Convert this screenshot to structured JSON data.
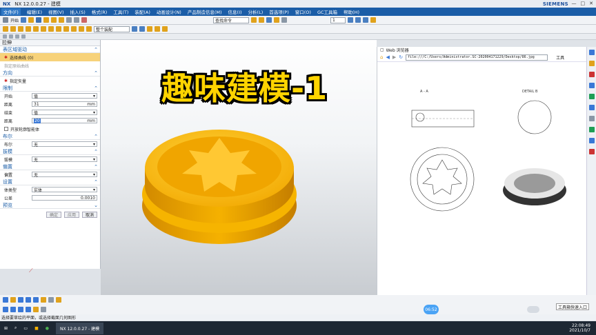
{
  "titlebar": {
    "app": "NX",
    "title": "NX 12.0.0.27 - 建模",
    "brand": "SIEMENS"
  },
  "menu": [
    "文件(F)",
    "编辑(E)",
    "视图(V)",
    "插入(S)",
    "格式(R)",
    "工具(T)",
    "装配(A)",
    "信息(I)",
    "分析(L)",
    "首选项(P)",
    "窗口(O)",
    "GC工具箱",
    "帮助(H)"
  ],
  "menu_items_with_extra": {
    "analysis": "动画设计(N)",
    "pmi": "产品制造信息(M)"
  },
  "toolbar": {
    "start_label": "开始",
    "filter_placeholder": "查找命令",
    "select_filter": "整个装配",
    "layer": "1"
  },
  "panel": {
    "title": "拉伸",
    "sections": {
      "profile": "表区域驱动",
      "select_curve": "选择曲线 (0)",
      "sketch_hint": "指定原始曲线",
      "direction": "方向",
      "vector": "指定矢量",
      "limits": "限制",
      "start": "开始",
      "start_val": "值",
      "distance": "距离",
      "distance_val": "31",
      "unit": "mm",
      "end": "结束",
      "end_val": "值",
      "end_distance": "距离",
      "end_distance_val": "20",
      "open_profile": "开放轮廓智能体",
      "boolean": "布尔",
      "boolean_label": "布尔",
      "boolean_val": "无",
      "draft": "拔模",
      "draft_label": "拔模",
      "draft_val": "无",
      "offset": "偏置",
      "offset_label": "偏置",
      "offset_val": "无",
      "settings": "设置",
      "body_type": "体类型",
      "body_type_val": "实体",
      "tolerance": "公差",
      "tolerance_val": "0.0010",
      "preview": "预览"
    },
    "buttons": {
      "ok": "确定",
      "apply": "应用",
      "cancel": "取消"
    }
  },
  "headline": "趣味建模-1",
  "browser": {
    "title": "Web 浏览器",
    "url": "file:///C:/Users/Administrator.SC-202004171229/Desktop/86.jpg",
    "tools": "工具",
    "drawing_labels": {
      "section": "A - A",
      "detail": "DETAIL B"
    }
  },
  "status": {
    "message": "选择要草绘的平面，或选择截面几何图形"
  },
  "tooltip": "工具箱快速入口",
  "time_badge": "06:52",
  "taskbar": {
    "app": "NX 12.0.0.27 - 建模",
    "time": "22:08:49",
    "date": "2021/10/7"
  },
  "colors": {
    "menubar": "#1b5da7",
    "part": "#f5b100",
    "headline": "#ffd400"
  }
}
